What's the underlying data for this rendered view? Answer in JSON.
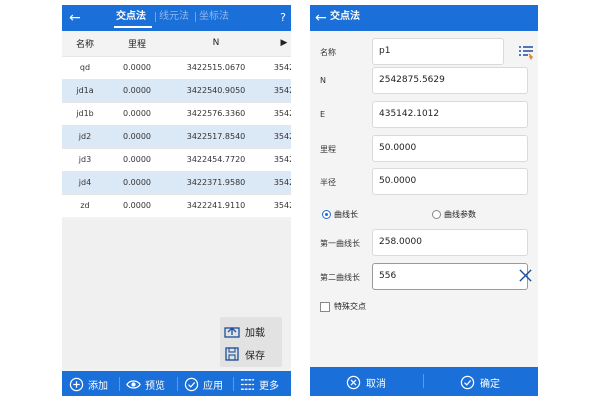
{
  "colors": {
    "primary": "#1b6fd8",
    "row_alt": "#dbe8f6"
  },
  "left": {
    "tabs": [
      {
        "label": "交点法",
        "active": true
      },
      {
        "label": "线元法",
        "active": false
      },
      {
        "label": "坐标法",
        "active": false
      }
    ],
    "help_label": "?",
    "table": {
      "headers": [
        "名称",
        "里程",
        "N",
        "▶"
      ],
      "rows": [
        {
          "name": "qd",
          "mileage": "0.0000",
          "n": "3422515.0670",
          "e": "3542"
        },
        {
          "name": "jd1a",
          "mileage": "0.0000",
          "n": "3422540.9050",
          "e": "3542"
        },
        {
          "name": "jd1b",
          "mileage": "0.0000",
          "n": "3422576.3360",
          "e": "3542"
        },
        {
          "name": "jd2",
          "mileage": "0.0000",
          "n": "3422517.8540",
          "e": "3542"
        },
        {
          "name": "jd3",
          "mileage": "0.0000",
          "n": "3422454.7720",
          "e": "3542"
        },
        {
          "name": "jd4",
          "mileage": "0.0000",
          "n": "3422371.9580",
          "e": "3542"
        },
        {
          "name": "zd",
          "mileage": "0.0000",
          "n": "3422241.9110",
          "e": "3542"
        }
      ]
    },
    "float_menu": {
      "load": "加载",
      "save": "保存"
    },
    "bottom": {
      "add": "添加",
      "preview": "预览",
      "apply": "应用",
      "more": "更多"
    }
  },
  "right": {
    "title": "交点法",
    "fields": {
      "name": {
        "label": "名称",
        "value": "p1"
      },
      "n": {
        "label": "N",
        "value": "2542875.5629"
      },
      "e": {
        "label": "E",
        "value": "435142.1012"
      },
      "mileage": {
        "label": "里程",
        "value": "50.0000"
      },
      "radius": {
        "label": "半径",
        "value": "50.0000"
      },
      "curve1": {
        "label": "第一曲线长",
        "value": "258.0000"
      },
      "curve2": {
        "label": "第二曲线长",
        "value": "556"
      }
    },
    "radio": {
      "option1": "曲线长",
      "option2": "曲线参数",
      "selected": "曲线长"
    },
    "checkbox": {
      "label": "特殊交点",
      "checked": false
    },
    "bottom": {
      "cancel": "取消",
      "ok": "确定"
    }
  }
}
